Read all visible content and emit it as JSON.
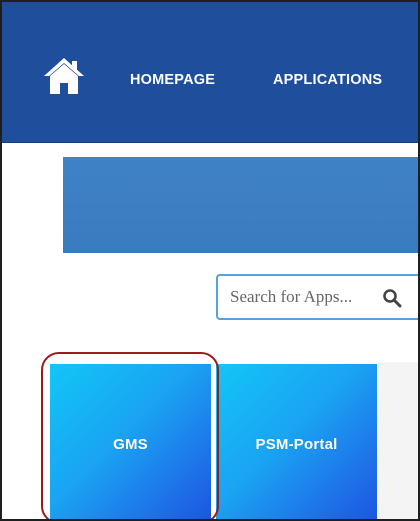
{
  "nav": {
    "home_icon": "home-icon",
    "links": [
      {
        "label": "HOMEPAGE"
      },
      {
        "label": "APPLICATIONS"
      }
    ]
  },
  "search": {
    "placeholder": "Search for Apps...",
    "value": "",
    "icon": "search-icon"
  },
  "apps": [
    {
      "label": "GMS"
    },
    {
      "label": "PSM-Portal"
    }
  ],
  "colors": {
    "navbar": "#1f4e9c",
    "banner": "#3f82c5",
    "search_border": "#55a3dd",
    "tile_start": "#12c6f7",
    "tile_end": "#1a55e0",
    "highlight": "#9b1b1b"
  }
}
